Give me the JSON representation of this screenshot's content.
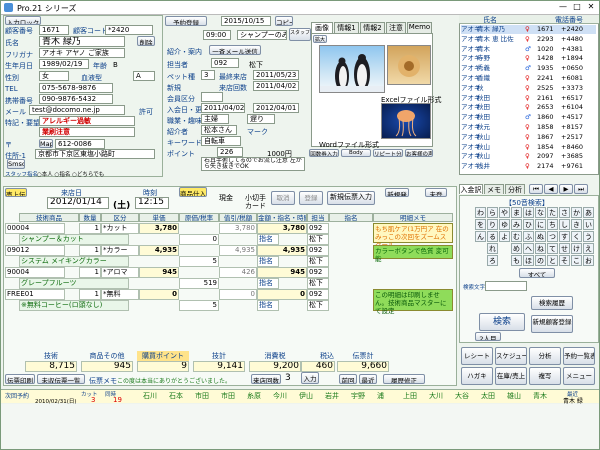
{
  "window": {
    "title": "Pro.21  シリーズ",
    "min": "—",
    "max": "□",
    "close": "✕"
  },
  "customer": {
    "search_btn": "入力ロック",
    "id_label": "顧客番号",
    "id": "1671",
    "code_label": "顧客コード",
    "code": "*2420",
    "delete_btn": "削除",
    "name_label": "氏名",
    "name": "青木 緑乃",
    "kana_label": "フリガナ",
    "kana": "アオキ アヤノ ご家族",
    "birth_label": "生年月日",
    "birth": "1989/02/19",
    "age_label": "年齢",
    "age_prefix": "B",
    "gender_label": "性別",
    "gender": "女",
    "blood_label": "血液型",
    "blood": "A",
    "tel_label": "TEL",
    "tel": "075-5678-9876",
    "mobile_label": "携帯番号",
    "mobile": "090-9876-5432",
    "mail_label": "メール",
    "mail": "test@docomo.ne.jp",
    "permit": "許可",
    "note_label": "特記・要望",
    "note1": "アレルギー過敏",
    "note2": "業刷注意",
    "zip_label": "〒",
    "zip_btn": "Map",
    "zip": "612-0086",
    "addr_label": "住所-1",
    "addr": "京都市下京区東塩小路町",
    "sms": "Smsc",
    "staff_label": "スタッフ指名",
    "staff_opts": "○本人  ○指名  ○どちらでも"
  },
  "visit": {
    "reserve_btn": "予約登録",
    "date": "2015/10/15",
    "copy": "コピー",
    "time": "09:00",
    "menu": "シャンプーのみ",
    "register_btn": "スタッフ登録",
    "intro_label": "紹介・案内",
    "mail_cast_btn": "一斉メール送信",
    "staff_label": "担当者",
    "staff": "092",
    "staff_name": "松下",
    "cast_label": "ペット種",
    "cast_num": "3",
    "last_label": "最終来店",
    "last_date": "2011/05/23",
    "new_label": "新規",
    "total_label": "来店回数",
    "total_date": "2011/04/02",
    "member_label": "会員区分",
    "first_label": "入会日・更新",
    "first1": "2011/04/02",
    "first2": "2012/04/01",
    "occupation_label": "職業・趣味",
    "occupation": "主婦",
    "occupation2": "遅り",
    "introducer_label": "紹介者",
    "introducer": "松本さん",
    "mark_label": "マーク",
    "keyword_label": "キーワード",
    "keyword": "自転車",
    "point_label": "ポイント",
    "point": "226",
    "point_amt": "1000円",
    "memo": "右耳手術してるのでお流し注意 左から失き抜きでOK",
    "ticket_btn": "回数券入力",
    "body_btn": "Body",
    "repeat_btn": "リピート分析",
    "rep_btn": "お客様の声"
  },
  "image_tabs": [
    "画像",
    "情報1",
    "情報2",
    "注意",
    "Memo"
  ],
  "image_panel": {
    "zoom": "拡大",
    "label1": "Excelファイル形式",
    "label2": "Wordファイル形式"
  },
  "list": {
    "headers": [
      "氏名",
      "電話番号"
    ],
    "rows": [
      {
        "kana": "アオキ",
        "name": "青木 緑乃",
        "sex": "♀",
        "no": "1671",
        "tel": "+2420"
      },
      {
        "kana": "アオキ",
        "name": "青木 恵 比佐",
        "sex": "♀",
        "no": "2293",
        "tel": "+4480"
      },
      {
        "kana": "アオキ",
        "name": "青木",
        "sex": "♂",
        "no": "1020",
        "tel": "+4381"
      },
      {
        "kana": "アオキ",
        "name": "寺野",
        "sex": "♀",
        "no": "1428",
        "tel": "+1894"
      },
      {
        "kana": "アオキ",
        "name": "秀義",
        "sex": "♂",
        "no": "1935",
        "tel": "+0650"
      },
      {
        "kana": "アオキ",
        "name": "香織",
        "sex": "♀",
        "no": "2241",
        "tel": "+6081"
      },
      {
        "kana": "アオキ",
        "name": "秋",
        "sex": "♀",
        "no": "2525",
        "tel": "+3373"
      },
      {
        "kana": "アオキ",
        "name": "秋田",
        "sex": "♀",
        "no": "2161",
        "tel": "+6517"
      },
      {
        "kana": "アオキ",
        "name": "秋田",
        "sex": "♀",
        "no": "2653",
        "tel": "+6104"
      },
      {
        "kana": "アオキ",
        "name": "秋田",
        "sex": "♂",
        "no": "1860",
        "tel": "+4517"
      },
      {
        "kana": "アオキ",
        "name": "秋元",
        "sex": "♀",
        "no": "1858",
        "tel": "+8157"
      },
      {
        "kana": "アオキ",
        "name": "秋山",
        "sex": "♀",
        "no": "1867",
        "tel": "+2517"
      },
      {
        "kana": "アオキ",
        "name": "秋山",
        "sex": "♀",
        "no": "1854",
        "tel": "+8460"
      },
      {
        "kana": "アオキ",
        "name": "秋山",
        "sex": "♀",
        "no": "2097",
        "tel": "+3685"
      },
      {
        "kana": "アオキ",
        "name": "浅井",
        "sex": "♀",
        "no": "2174",
        "tel": "+9761"
      }
    ]
  },
  "slip": {
    "title": "売上伝票",
    "date_label": "来店日",
    "date": "2012/01/14",
    "dow": "(土)",
    "time_label": "時刻",
    "time": "12:15",
    "product_label": "商品仕入",
    "cash": "現金",
    "card": "小切手",
    "other": "カード",
    "cancel_btn": "取消",
    "register_btn": "登録",
    "new_btn": "新規伝票入力",
    "new2": "新規発",
    "not_yet": "未登",
    "headers": [
      "技術商品",
      "数量",
      "区分",
      "単価",
      "原価/税率",
      "值引/税額",
      "金額・指名・時間",
      "担当",
      "指名",
      "明細メモ"
    ],
    "rows": [
      {
        "code": "00004",
        "name": "シャンプー＆カット",
        "qty": "1",
        "cls": "*カット",
        "price": "3,780",
        "cost": "0",
        "disc": "3,780",
        "amt": "3,780",
        "staff": "092",
        "staff_name": "松下",
        "mark": "指名"
      },
      {
        "code": "09012",
        "name": "システム  メイキングカラー",
        "qty": "1",
        "cls": "*カラー",
        "price": "4,935",
        "cost": "5",
        "disc": "4,935",
        "amt": "4,935",
        "staff": "092",
        "staff_name": "松下",
        "mark": "指名"
      },
      {
        "code": "90004",
        "name": "グレープフルーツ",
        "qty": "1",
        "cls": "*アロマ",
        "price": "945",
        "cost": "519",
        "disc": "426",
        "amt": "945",
        "staff": "092",
        "staff_name": "松下",
        "mark": "指名"
      },
      {
        "code": "FREE01",
        "name": "※無料コーヒー(ロ頭なし)",
        "qty": "1",
        "cls": "*無料",
        "price": "0",
        "cost": "5",
        "disc": "0",
        "amt": "0",
        "staff": "092",
        "staff_name": "松下",
        "mark": "指名"
      }
    ],
    "memo1": "もち肌ケア(1万円ア 在のみっこの次回をズームスクール",
    "memo2": "カラーボタンで色質 変可能",
    "memo3": "この明細は印刷しません。技術商品マスターにて設定",
    "totals_labels": [
      "技術",
      "商品その他",
      "購買ポイント",
      "技計",
      "消費税",
      "税込",
      "伝票計"
    ],
    "tech": "8,715",
    "goods": "945",
    "points": "9",
    "subtotal": "9,141",
    "tax": "9,200",
    "taxin": "460",
    "total": "9,660",
    "print_btn": "伝票印刷",
    "list_btn": "未収伝票一覧",
    "memo_label": "伝票メモ",
    "memo_text": "この度は本当にありがとうございました。",
    "come_btn": "来店回数",
    "come_count": "3",
    "pay_btn": "入力",
    "prev_btn": "前回",
    "latest_btn": "最近",
    "history_btn": "履歴修正"
  },
  "side_tabs": [
    "入金訳",
    "メモ",
    "分析"
  ],
  "search50": {
    "title": "【50音検索】",
    "rows": [
      [
        "わ",
        "ら",
        "や",
        "ま",
        "は",
        "な",
        "た",
        "さ",
        "か",
        "あ"
      ],
      [
        "を",
        "り",
        "ゆ",
        "み",
        "ひ",
        "に",
        "ち",
        "し",
        "き",
        "い"
      ],
      [
        "ん",
        "る",
        "よ",
        "む",
        "ふ",
        "ぬ",
        "つ",
        "す",
        "く",
        "う"
      ],
      [
        "",
        "れ",
        "",
        "め",
        "へ",
        "ね",
        "て",
        "せ",
        "け",
        "え"
      ],
      [
        "",
        "ろ",
        "",
        "も",
        "ほ",
        "の",
        "と",
        "そ",
        "こ",
        "お"
      ]
    ],
    "all_btn": "すべて",
    "history_btn": "検索履歴",
    "search_btn": "検索",
    "new_btn": "新規顧客登録",
    "search_label": "検索文字",
    "two_btn": "2人目"
  },
  "menu_buttons": [
    "レシート",
    "スケジュール",
    "分析",
    "予約一覧表",
    "ハガキ",
    "在庫/売上",
    "複写",
    "メニュー"
  ],
  "footer": {
    "next_label": "次回予約",
    "next_date": "2010/02/31(日)",
    "cat1": "カット",
    "cat2": "同時",
    "num1": "3",
    "num2": "19",
    "names": [
      "石川",
      "石本",
      "市田",
      "市田",
      "糸原",
      "今川",
      "伊山",
      "岩井",
      "宇野",
      "浦",
      "上田",
      "大川",
      "大谷",
      "太田",
      "雄山",
      "青木"
    ],
    "tail_label": "最近",
    "tail_name": "青木 緑"
  }
}
